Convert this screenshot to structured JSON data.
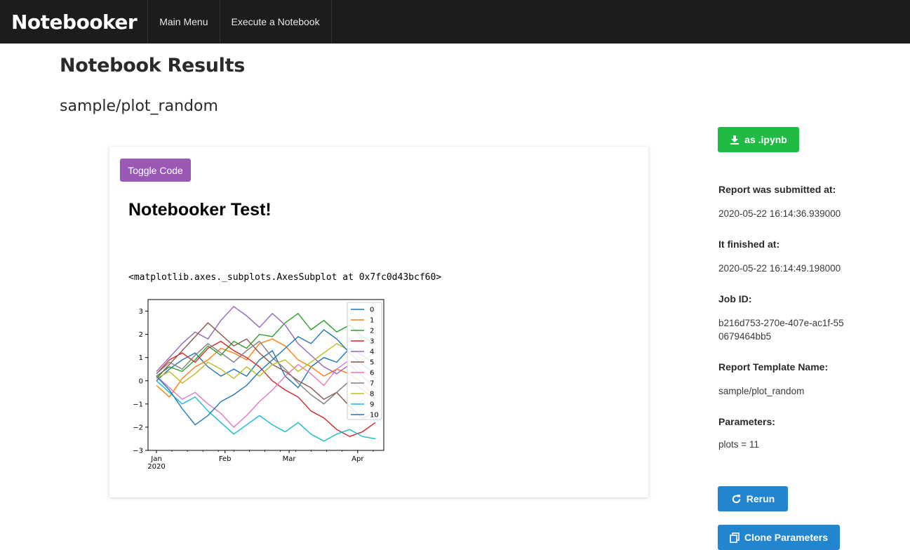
{
  "navbar": {
    "brand": "Notebooker",
    "items": [
      "Main Menu",
      "Execute a Notebook"
    ]
  },
  "page": {
    "title": "Notebook Results",
    "notebook_path": "sample/plot_random"
  },
  "card": {
    "toggle_label": "Toggle Code",
    "notebook_title": "Notebooker Test!",
    "output_text": "<matplotlib.axes._subplots.AxesSubplot at 0x7fc0d43bcf60>"
  },
  "sidebar": {
    "download_label": "as .ipynb",
    "submitted_label": "Report was submitted at:",
    "submitted_value": "2020-05-22 16:14:36.939000",
    "finished_label": "It finished at:",
    "finished_value": "2020-05-22 16:14:49.198000",
    "job_label": "Job ID:",
    "job_value": "b216d753-270e-407e-ac1f-550679464bb5",
    "template_label": "Report Template Name:",
    "template_value": "sample/plot_random",
    "params_label": "Parameters:",
    "params_value": "plots = 11",
    "rerun_label": "Rerun",
    "clone_label": "Clone Parameters"
  },
  "colors": {
    "navbar": "#1b1c1d",
    "toggle": "#9b59b6",
    "download": "#21ba45",
    "primary": "#2185d0"
  },
  "chart_data": {
    "type": "line",
    "title": "",
    "xlabel": "",
    "ylabel": "",
    "x_ticks": [
      "Jan\n2020",
      "Feb",
      "Mar",
      "Apr"
    ],
    "x_start": "2020-01-01",
    "x_end": "2020-04-09",
    "ylim": [
      -3,
      3.5
    ],
    "y_ticks": [
      -3,
      -2,
      -1,
      0,
      1,
      2,
      3
    ],
    "legend_position": "top-right",
    "grid": false,
    "series": [
      {
        "name": "0",
        "color": "#1f77b4",
        "values": [
          0.0,
          0.5,
          0.9,
          1.2,
          0.6,
          0.2,
          0.5,
          0.2,
          0.9,
          1.3,
          0.2,
          -0.3,
          0.6,
          1.0,
          0.8,
          1.4,
          1.1,
          0.7
        ]
      },
      {
        "name": "1",
        "color": "#ff7f0e",
        "values": [
          -0.2,
          -0.7,
          0.1,
          0.6,
          0.9,
          1.4,
          1.2,
          0.9,
          1.6,
          1.8,
          1.5,
          0.9,
          0.6,
          0.2,
          0.5,
          0.3,
          -0.1,
          -0.8
        ]
      },
      {
        "name": "2",
        "color": "#2ca02c",
        "values": [
          0.2,
          0.6,
          0.4,
          0.9,
          1.5,
          1.1,
          1.7,
          1.4,
          2.0,
          1.9,
          2.5,
          2.9,
          2.2,
          2.6,
          2.1,
          2.4,
          1.9,
          1.6
        ]
      },
      {
        "name": "3",
        "color": "#d62728",
        "values": [
          0.3,
          0.9,
          1.2,
          0.8,
          1.4,
          1.7,
          1.3,
          1.0,
          0.6,
          0.0,
          -0.4,
          -0.7,
          -1.3,
          -1.6,
          -2.1,
          -2.4,
          -2.2,
          -1.8
        ]
      },
      {
        "name": "4",
        "color": "#9467bd",
        "values": [
          0.4,
          1.0,
          1.6,
          2.1,
          1.8,
          2.6,
          3.2,
          2.8,
          2.3,
          2.9,
          2.4,
          1.6,
          1.1,
          0.6,
          0.3,
          0.7,
          0.2,
          -0.3
        ]
      },
      {
        "name": "5",
        "color": "#8c564b",
        "values": [
          0.1,
          0.7,
          1.3,
          1.9,
          2.5,
          2.0,
          1.5,
          1.8,
          1.2,
          0.7,
          0.4,
          0.0,
          -0.3,
          -0.8,
          -0.5,
          -1.1,
          -1.6,
          -1.4
        ]
      },
      {
        "name": "6",
        "color": "#e377c2",
        "values": [
          0.2,
          -0.3,
          -0.8,
          -0.5,
          -1.0,
          -1.4,
          -2.0,
          -1.5,
          -0.9,
          -0.4,
          0.2,
          0.7,
          0.3,
          -0.2,
          0.5,
          0.9,
          0.4,
          0.1
        ]
      },
      {
        "name": "7",
        "color": "#7f7f7f",
        "values": [
          0.3,
          0.8,
          0.5,
          1.1,
          1.6,
          1.2,
          0.8,
          1.3,
          1.7,
          1.0,
          0.5,
          -0.1,
          -0.6,
          -1.0,
          -0.5,
          0.0,
          -0.4,
          -0.8
        ]
      },
      {
        "name": "8",
        "color": "#bcbd22",
        "values": [
          0.1,
          0.4,
          -0.1,
          0.3,
          0.8,
          0.5,
          0.1,
          0.6,
          0.2,
          0.7,
          0.9,
          0.4,
          0.8,
          1.2,
          1.6,
          1.3,
          0.9,
          1.2
        ]
      },
      {
        "name": "9",
        "color": "#17becf",
        "values": [
          0.0,
          -0.5,
          -1.0,
          -0.7,
          -1.3,
          -1.8,
          -2.3,
          -1.9,
          -1.5,
          -1.9,
          -2.2,
          -1.8,
          -2.3,
          -2.6,
          -2.3,
          -2.1,
          -2.4,
          -2.5
        ]
      },
      {
        "name": "10",
        "color": "#1f77b4",
        "values": [
          0.2,
          -0.4,
          -1.2,
          -1.9,
          -1.5,
          -0.9,
          -0.6,
          -0.2,
          0.4,
          0.9,
          1.4,
          1.9,
          1.6,
          2.2,
          1.8,
          1.2,
          0.7,
          0.3
        ]
      }
    ]
  }
}
